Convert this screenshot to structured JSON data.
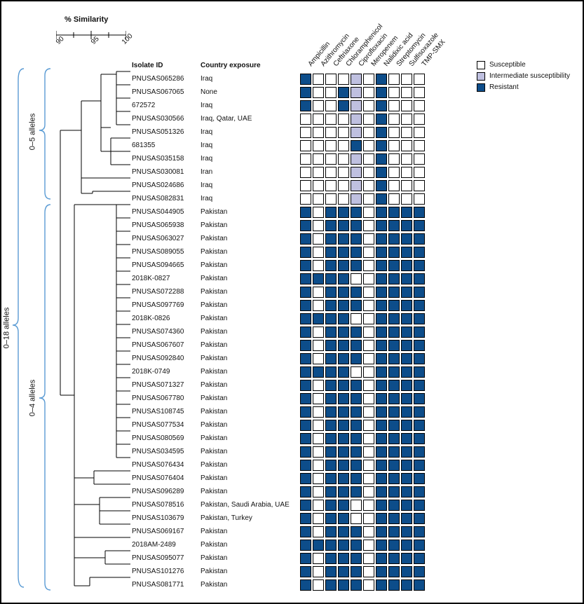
{
  "similarity": {
    "label": "% Similarity",
    "ticks": [
      "90",
      "95",
      "100"
    ]
  },
  "columns": {
    "isolate": "Isolate ID",
    "country": "Country exposure"
  },
  "antibiotics": [
    "Ampicillin",
    "Azithromycin",
    "Ceftriaxone",
    "Chloramphenicol",
    "Ciprofloxacin",
    "Meropenem",
    "Nalidixic acid",
    "Streptomycin",
    "Sulfisoxazole",
    "TMP-SMX"
  ],
  "legend": {
    "susceptible": "Susceptible",
    "intermediate": "Intermediate susceptibility",
    "resistant": "Resistant"
  },
  "braces": {
    "overall": "0–18 alleles",
    "top": "0–5 alleles",
    "bottom": "0–4 alleles"
  },
  "chart_data": {
    "type": "heatmap",
    "title": "",
    "x_categories_key": "antibiotics",
    "value_encoding": {
      "S": "Susceptible",
      "I": "Intermediate susceptibility",
      "R": "Resistant"
    },
    "rows": [
      {
        "isolate": "PNUSAS065286",
        "country": "Iraq",
        "vals": [
          "R",
          "S",
          "S",
          "S",
          "I",
          "S",
          "R",
          "S",
          "S",
          "S"
        ],
        "cluster": "top"
      },
      {
        "isolate": "PNUSAS067065",
        "country": "None",
        "vals": [
          "R",
          "S",
          "S",
          "R",
          "I",
          "S",
          "R",
          "S",
          "S",
          "S"
        ],
        "cluster": "top"
      },
      {
        "isolate": "672572",
        "country": "Iraq",
        "vals": [
          "R",
          "S",
          "S",
          "R",
          "I",
          "S",
          "R",
          "S",
          "S",
          "S"
        ],
        "cluster": "top"
      },
      {
        "isolate": "PNUSAS030566",
        "country": "Iraq, Qatar, UAE",
        "vals": [
          "S",
          "S",
          "S",
          "S",
          "I",
          "S",
          "R",
          "S",
          "S",
          "S"
        ],
        "cluster": "top"
      },
      {
        "isolate": "PNUSAS051326",
        "country": "Iraq",
        "vals": [
          "S",
          "S",
          "S",
          "S",
          "I",
          "S",
          "R",
          "S",
          "S",
          "S"
        ],
        "cluster": "top"
      },
      {
        "isolate": "681355",
        "country": "Iraq",
        "vals": [
          "S",
          "S",
          "S",
          "S",
          "R",
          "S",
          "R",
          "S",
          "S",
          "S"
        ],
        "cluster": "top"
      },
      {
        "isolate": "PNUSAS035158",
        "country": "Iraq",
        "vals": [
          "S",
          "S",
          "S",
          "S",
          "I",
          "S",
          "R",
          "S",
          "S",
          "S"
        ],
        "cluster": "top"
      },
      {
        "isolate": "PNUSAS030081",
        "country": "Iran",
        "vals": [
          "S",
          "S",
          "S",
          "S",
          "I",
          "S",
          "R",
          "S",
          "S",
          "S"
        ],
        "cluster": "top"
      },
      {
        "isolate": "PNUSAS024686",
        "country": "Iraq",
        "vals": [
          "S",
          "S",
          "S",
          "S",
          "I",
          "S",
          "R",
          "S",
          "S",
          "S"
        ],
        "cluster": "top"
      },
      {
        "isolate": "PNUSAS082831",
        "country": "Iraq",
        "vals": [
          "S",
          "S",
          "S",
          "S",
          "I",
          "S",
          "R",
          "S",
          "S",
          "S"
        ],
        "cluster": "top"
      },
      {
        "isolate": "PNUSAS044905",
        "country": "Pakistan",
        "vals": [
          "R",
          "S",
          "R",
          "R",
          "R",
          "S",
          "R",
          "R",
          "R",
          "R"
        ],
        "cluster": "bottom"
      },
      {
        "isolate": "PNUSAS065938",
        "country": "Pakistan",
        "vals": [
          "R",
          "S",
          "R",
          "R",
          "R",
          "S",
          "R",
          "R",
          "R",
          "R"
        ],
        "cluster": "bottom"
      },
      {
        "isolate": "PNUSAS063027",
        "country": "Pakistan",
        "vals": [
          "R",
          "S",
          "R",
          "R",
          "R",
          "S",
          "R",
          "R",
          "R",
          "R"
        ],
        "cluster": "bottom"
      },
      {
        "isolate": "PNUSAS089055",
        "country": "Pakistan",
        "vals": [
          "R",
          "S",
          "R",
          "R",
          "R",
          "S",
          "R",
          "R",
          "R",
          "R"
        ],
        "cluster": "bottom"
      },
      {
        "isolate": "PNUSAS094665",
        "country": "Pakistan",
        "vals": [
          "R",
          "S",
          "R",
          "R",
          "R",
          "S",
          "R",
          "R",
          "R",
          "R"
        ],
        "cluster": "bottom"
      },
      {
        "isolate": "2018K-0827",
        "country": "Pakistan",
        "vals": [
          "R",
          "R",
          "R",
          "R",
          "S",
          "S",
          "R",
          "R",
          "R",
          "R"
        ],
        "cluster": "bottom"
      },
      {
        "isolate": "PNUSAS072288",
        "country": "Pakistan",
        "vals": [
          "R",
          "S",
          "R",
          "R",
          "R",
          "S",
          "R",
          "R",
          "R",
          "R"
        ],
        "cluster": "bottom"
      },
      {
        "isolate": "PNUSAS097769",
        "country": "Pakistan",
        "vals": [
          "R",
          "S",
          "R",
          "R",
          "R",
          "S",
          "R",
          "R",
          "R",
          "R"
        ],
        "cluster": "bottom"
      },
      {
        "isolate": "2018K-0826",
        "country": "Pakistan",
        "vals": [
          "R",
          "R",
          "R",
          "R",
          "S",
          "S",
          "R",
          "R",
          "R",
          "R"
        ],
        "cluster": "bottom"
      },
      {
        "isolate": "PNUSAS074360",
        "country": "Pakistan",
        "vals": [
          "R",
          "S",
          "R",
          "R",
          "R",
          "S",
          "R",
          "R",
          "R",
          "R"
        ],
        "cluster": "bottom"
      },
      {
        "isolate": "PNUSAS067607",
        "country": "Pakistan",
        "vals": [
          "R",
          "S",
          "R",
          "R",
          "R",
          "S",
          "R",
          "R",
          "R",
          "R"
        ],
        "cluster": "bottom"
      },
      {
        "isolate": "PNUSAS092840",
        "country": "Pakistan",
        "vals": [
          "R",
          "S",
          "R",
          "R",
          "R",
          "S",
          "R",
          "R",
          "R",
          "R"
        ],
        "cluster": "bottom"
      },
      {
        "isolate": "2018K-0749",
        "country": "Pakistan",
        "vals": [
          "R",
          "R",
          "R",
          "R",
          "S",
          "S",
          "R",
          "R",
          "R",
          "R"
        ],
        "cluster": "bottom"
      },
      {
        "isolate": "PNUSAS071327",
        "country": "Pakistan",
        "vals": [
          "R",
          "S",
          "R",
          "R",
          "R",
          "S",
          "R",
          "R",
          "R",
          "R"
        ],
        "cluster": "bottom"
      },
      {
        "isolate": "PNUSAS067780",
        "country": "Pakistan",
        "vals": [
          "R",
          "S",
          "R",
          "R",
          "R",
          "S",
          "R",
          "R",
          "R",
          "R"
        ],
        "cluster": "bottom"
      },
      {
        "isolate": "PNUSAS108745",
        "country": "Pakistan",
        "vals": [
          "R",
          "S",
          "R",
          "R",
          "R",
          "S",
          "R",
          "R",
          "R",
          "R"
        ],
        "cluster": "bottom"
      },
      {
        "isolate": "PNUSAS077534",
        "country": "Pakistan",
        "vals": [
          "R",
          "S",
          "R",
          "R",
          "R",
          "S",
          "R",
          "R",
          "R",
          "R"
        ],
        "cluster": "bottom"
      },
      {
        "isolate": "PNUSAS080569",
        "country": "Pakistan",
        "vals": [
          "R",
          "S",
          "R",
          "R",
          "R",
          "S",
          "R",
          "R",
          "R",
          "R"
        ],
        "cluster": "bottom"
      },
      {
        "isolate": "PNUSAS034595",
        "country": "Pakistan",
        "vals": [
          "R",
          "S",
          "R",
          "R",
          "R",
          "S",
          "R",
          "R",
          "R",
          "R"
        ],
        "cluster": "bottom"
      },
      {
        "isolate": "PNUSAS076434",
        "country": "Pakistan",
        "vals": [
          "R",
          "S",
          "R",
          "R",
          "R",
          "S",
          "R",
          "R",
          "R",
          "R"
        ],
        "cluster": "bottom"
      },
      {
        "isolate": "PNUSAS076404",
        "country": "Pakistan",
        "vals": [
          "R",
          "S",
          "R",
          "R",
          "R",
          "S",
          "R",
          "R",
          "R",
          "R"
        ],
        "cluster": "bottom"
      },
      {
        "isolate": "PNUSAS096289",
        "country": "Pakistan",
        "vals": [
          "R",
          "S",
          "R",
          "R",
          "R",
          "S",
          "R",
          "R",
          "R",
          "R"
        ],
        "cluster": "bottom"
      },
      {
        "isolate": "PNUSAS078516",
        "country": "Pakistan, Saudi Arabia, UAE",
        "vals": [
          "R",
          "S",
          "R",
          "R",
          "S",
          "S",
          "R",
          "R",
          "R",
          "R"
        ],
        "cluster": "bottom"
      },
      {
        "isolate": "PNUSAS103679",
        "country": "Pakistan, Turkey",
        "vals": [
          "R",
          "S",
          "R",
          "R",
          "S",
          "S",
          "R",
          "R",
          "R",
          "R"
        ],
        "cluster": "bottom"
      },
      {
        "isolate": "PNUSAS069167",
        "country": "Pakistan",
        "vals": [
          "R",
          "S",
          "R",
          "R",
          "R",
          "S",
          "R",
          "R",
          "R",
          "R"
        ],
        "cluster": "bottom"
      },
      {
        "isolate": "2018AM-2489",
        "country": "Pakistan",
        "vals": [
          "R",
          "R",
          "R",
          "R",
          "R",
          "S",
          "R",
          "R",
          "R",
          "R"
        ],
        "cluster": "bottom"
      },
      {
        "isolate": "PNUSAS095077",
        "country": "Pakistan",
        "vals": [
          "R",
          "S",
          "R",
          "R",
          "R",
          "S",
          "R",
          "R",
          "R",
          "R"
        ],
        "cluster": "bottom"
      },
      {
        "isolate": "PNUSAS101276",
        "country": "Pakistan",
        "vals": [
          "R",
          "S",
          "R",
          "R",
          "R",
          "S",
          "R",
          "R",
          "R",
          "R"
        ],
        "cluster": "bottom"
      },
      {
        "isolate": "PNUSAS081771",
        "country": "Pakistan",
        "vals": [
          "R",
          "S",
          "R",
          "R",
          "R",
          "S",
          "R",
          "R",
          "R",
          "R"
        ],
        "cluster": "bottom"
      }
    ]
  }
}
